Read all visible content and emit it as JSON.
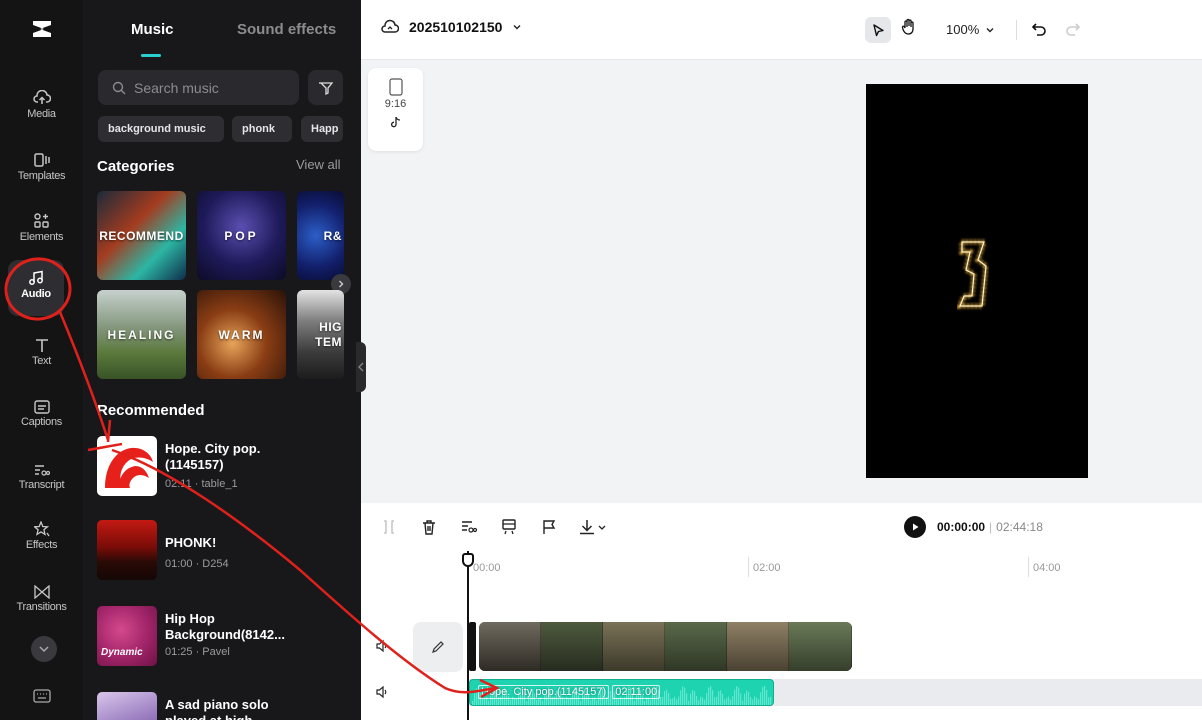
{
  "rail": {
    "items": [
      {
        "label": "Media",
        "icon": "cloud-upload-icon"
      },
      {
        "label": "Templates",
        "icon": "templates-icon"
      },
      {
        "label": "Elements",
        "icon": "elements-icon"
      },
      {
        "label": "Audio",
        "icon": "music-note-icon",
        "active": true
      },
      {
        "label": "Text",
        "icon": "text-t-icon"
      },
      {
        "label": "Captions",
        "icon": "captions-icon"
      },
      {
        "label": "Transcript",
        "icon": "transcript-icon"
      },
      {
        "label": "Effects",
        "icon": "effects-star-icon"
      },
      {
        "label": "Transitions",
        "icon": "transitions-icon"
      }
    ]
  },
  "panel": {
    "tabs": [
      "Music",
      "Sound effects"
    ],
    "search_placeholder": "Search music",
    "chips": [
      "background music",
      "phonk",
      "Happ"
    ],
    "categories_title": "Categories",
    "view_all": "View all",
    "categories": [
      "RECOMMEND",
      "POP",
      "R&",
      "HEALING",
      "WARM",
      "HIG\nTEM"
    ],
    "recommended_title": "Recommended",
    "tracks": [
      {
        "title": "Hope. City pop.\n(1145157)",
        "meta": "02:11 · table_1"
      },
      {
        "title": "PHONK!",
        "meta": "01:00 · D254"
      },
      {
        "title": "Hip Hop\nBackground(8142...",
        "meta": "01:25 · Pavel",
        "badge": "Dynamic"
      },
      {
        "title": "A sad piano solo\nplayed at high",
        "meta": ""
      }
    ]
  },
  "topbar": {
    "project_name": "202510102150",
    "zoom": "100%"
  },
  "stage": {
    "ratio_label": "9:16"
  },
  "player": {
    "current_time": "00:00:00",
    "separator": "|",
    "duration": "02:44:18"
  },
  "timeline": {
    "ruler_labels": [
      "00:00",
      "02:00",
      "04:00"
    ],
    "audio_clip_name": "Hope. City pop.(1145157)",
    "audio_clip_duration": "02:11:00"
  },
  "colors": {
    "accent": "#2ad0d0",
    "audio_clip": "#1dd3b0",
    "annotation": "#e0211b"
  }
}
